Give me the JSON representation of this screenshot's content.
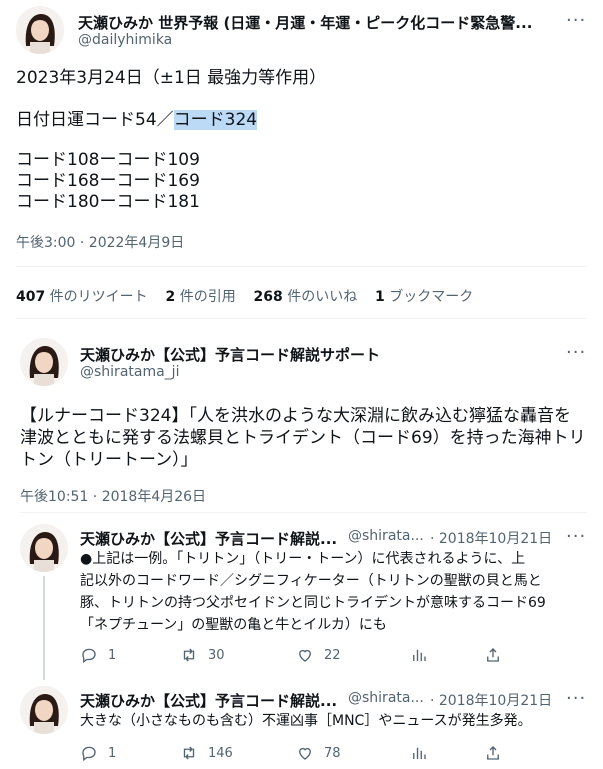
{
  "tweet": {
    "display_name": "天瀬ひみか 世界予報 (日運・月運・年運・ピーク化コード緊急警...",
    "handle": "@dailyhimika",
    "lines": [
      "2023年3月24日（±1日 最強力等作用）",
      "日付日運コード54／",
      "コード324",
      "コード108ーコード109",
      "コード168ーコード169",
      "コード180ーコード181"
    ],
    "timestamp": "午後3:00 · 2022年4月9日",
    "stats": {
      "retweets_n": "407",
      "retweets_l": " 件のリツイート",
      "quotes_n": "2",
      "quotes_l": " 件の引用",
      "likes_n": "268",
      "likes_l": " 件のいいね",
      "bookmarks_n": "1",
      "bookmarks_l": " ブックマーク"
    }
  },
  "quote": {
    "display_name": "天瀬ひみか【公式】予言コード解説サポート",
    "handle": "@shiratama_ji",
    "lines": [
      "【ルナーコード324】「人を洪水のような大深淵に飲み込む獰猛な轟音を",
      "津波とともに発する法螺貝とトライデント（コード69）を持った海神トリ",
      "トン（トリートーン）」"
    ],
    "timestamp": "午後10:51 · 2018年4月26日"
  },
  "replies": [
    {
      "display_name": "天瀬ひみか【公式】予言コード解説...",
      "handle": "@shirata...",
      "date": "· 2018年10月21日",
      "lines": [
        "●上記は一例。「トリトン」（トリー・トーン）に代表されるように、上",
        "記以外のコードワード／シグニフィケーター（トリトンの聖獣の貝と馬と",
        "豚、トリトンの持つ父ポセイドンと同じトライデントが意味するコード69",
        "「ネプチューン」の聖獣の亀と牛とイルカ）にも"
      ],
      "actions": {
        "reply": "1",
        "retweet": "30",
        "like": "22"
      }
    },
    {
      "display_name": "天瀬ひみか【公式】予言コード解説...",
      "handle": "@shirata...",
      "date": "· 2018年10月21日",
      "lines": [
        "大きな（小さなものも含む）不運凶事［MNC］やニュースが発生多発。"
      ],
      "actions": {
        "reply": "1",
        "retweet": "146",
        "like": "78"
      }
    }
  ],
  "icons": {
    "more": "more-icon",
    "reply": "reply-icon",
    "retweet": "retweet-icon",
    "like": "like-icon",
    "analytics": "analytics-icon",
    "share": "share-icon"
  },
  "colors": {
    "text": "#0f1419",
    "muted": "#536471",
    "highlight": "#bcd9f5",
    "divider": "#eff3f4"
  }
}
